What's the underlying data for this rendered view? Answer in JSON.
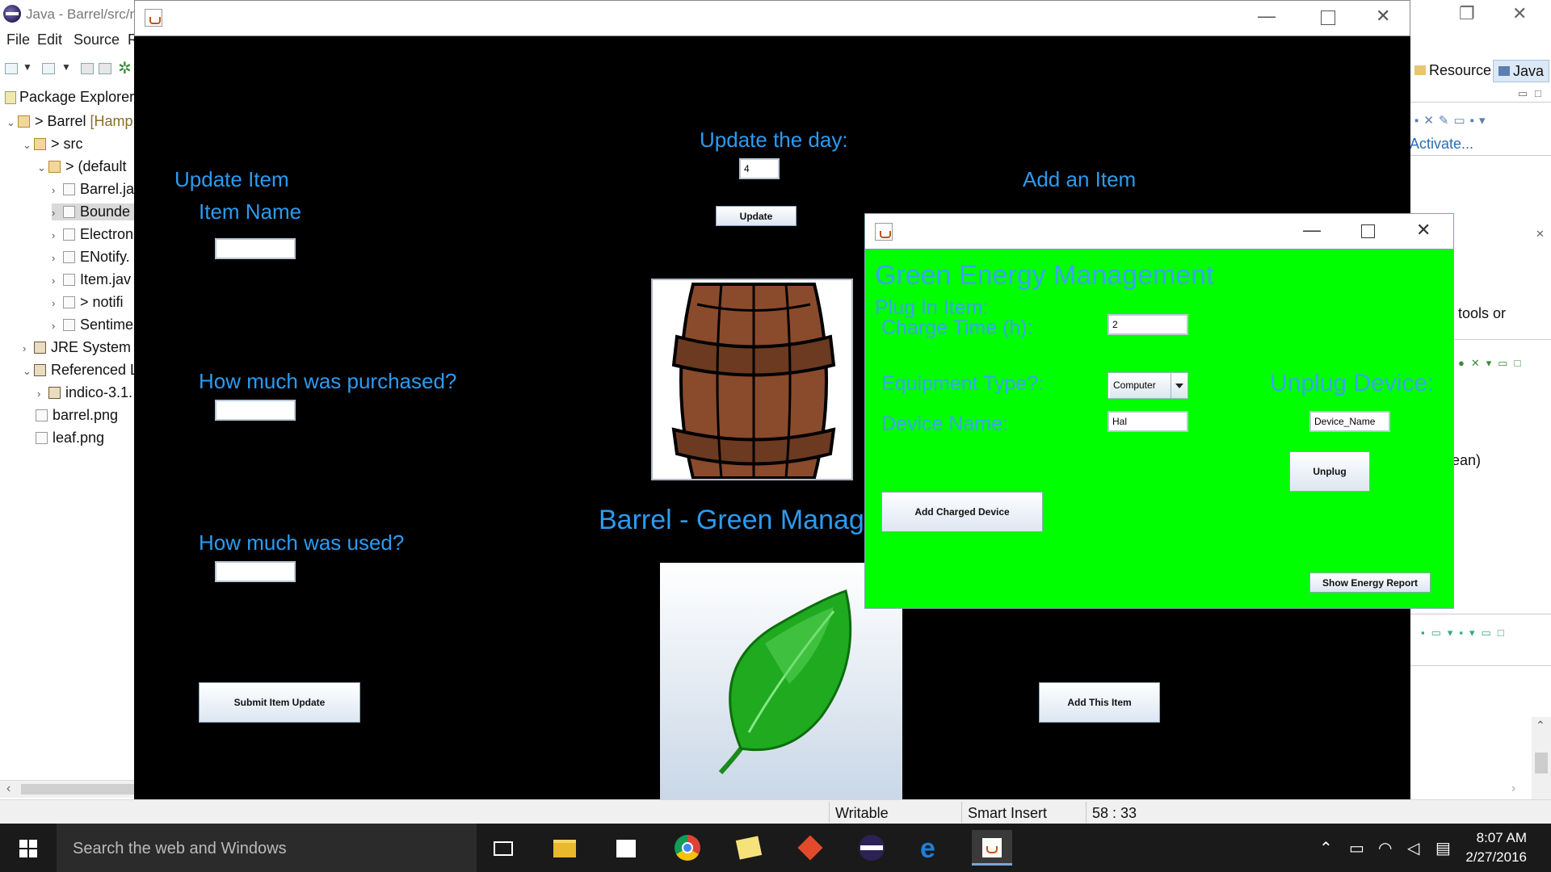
{
  "eclipse": {
    "window_title": "Java - Barrel/src/n",
    "menu": [
      "File",
      "Edit",
      "Source",
      "R"
    ],
    "package_explorer_tab": "Package Explorer",
    "tree": [
      {
        "label": "> Barrel",
        "suffix": " [Hamp"
      },
      {
        "label": "> src"
      },
      {
        "label": "> (default"
      },
      {
        "label": "Barrel.ja"
      },
      {
        "label": "Bounde"
      },
      {
        "label": "Electron"
      },
      {
        "label": "ENotify."
      },
      {
        "label": "Item.jav"
      },
      {
        "label": "> notifi"
      },
      {
        "label": "Sentime"
      },
      {
        "label": "JRE System L"
      },
      {
        "label": "Referenced L"
      },
      {
        "label": "indico-3.1."
      },
      {
        "label": "barrel.png"
      },
      {
        "label": "leaf.png"
      }
    ],
    "perspectives": {
      "resource": "Resource",
      "java": "Java"
    },
    "right_panel": {
      "activate": "Activate...",
      "tools_or": "tools or",
      "ean": "ean)"
    },
    "status": {
      "writable": "Writable",
      "insert_mode": "Smart Insert",
      "position": "58 : 33"
    }
  },
  "barrel_window": {
    "update_day_label": "Update the day:",
    "day_value": "4",
    "update_button": "Update",
    "update_item_heading": "Update Item",
    "item_name_label": "Item Name",
    "purchased_label": "How much was purchased?",
    "used_label": "How much was used?",
    "main_title": "Barrel - Green Manag",
    "add_item_heading": "Add an Item",
    "submit_button": "Submit Item Update",
    "add_item_button": "Add This Item"
  },
  "green_window": {
    "title": "Green Energy Management",
    "plug_in_label": "Plug In Item:",
    "charge_time_label": "Charge Time (h):",
    "charge_time_value": "2",
    "equipment_label": "Equipment Type?:",
    "equipment_value": "Computer",
    "device_name_label": "Device Name:",
    "device_name_value": "Hal",
    "unplug_heading": "Unplug Device:",
    "unplug_name_value": "Device_Name",
    "unplug_button": "Unplug",
    "add_charged_button": "Add Charged Device",
    "energy_report_button": "Show Energy Report",
    "background_color": "#00ff00"
  },
  "taskbar": {
    "search_placeholder": "Search the web and Windows",
    "time": "8:07 AM",
    "date": "2/27/2016"
  }
}
